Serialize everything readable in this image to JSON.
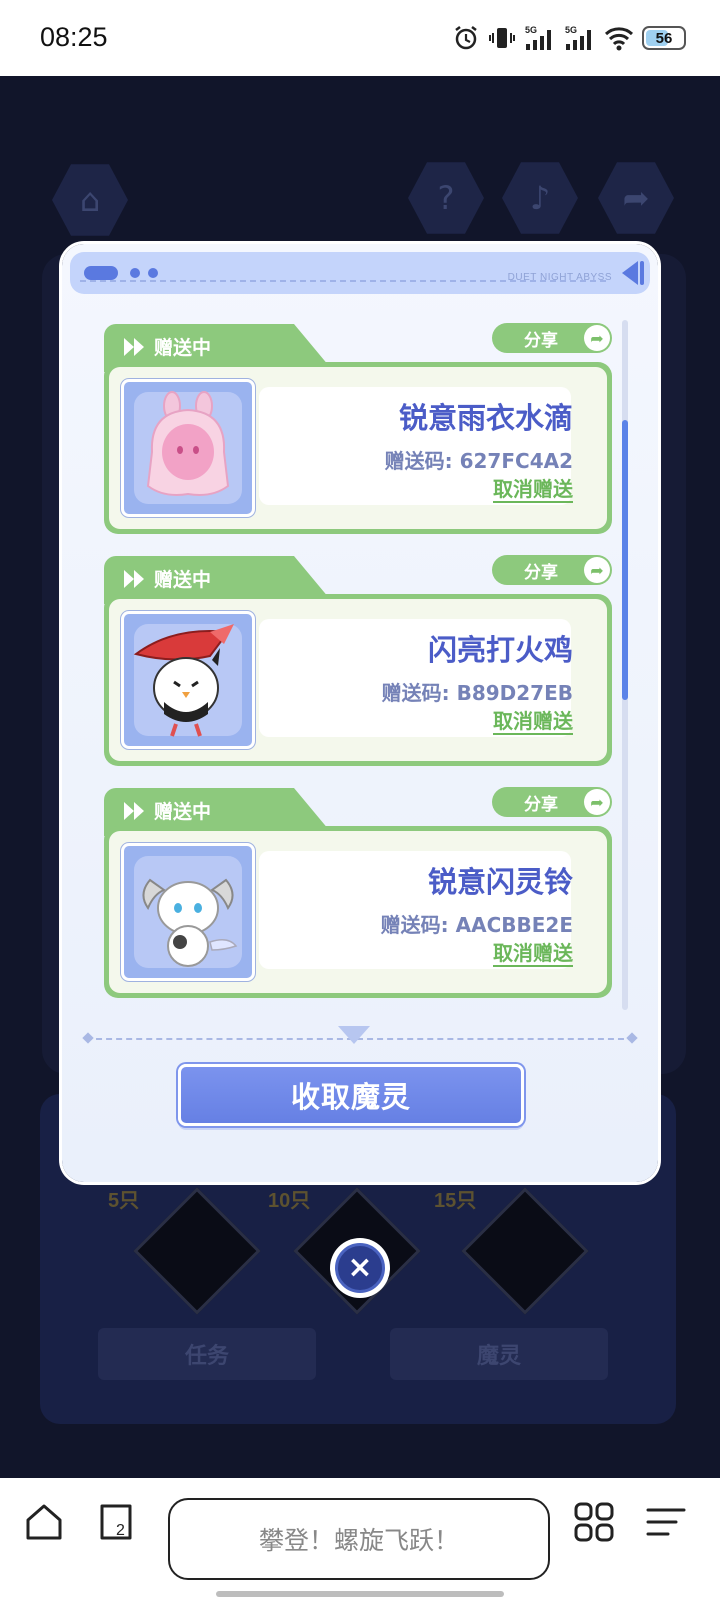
{
  "status_bar": {
    "time": "08:25",
    "signal_label_1": "5G",
    "signal_label_2": "5G",
    "battery": "56"
  },
  "background_game": {
    "counts": [
      "5只",
      "10只",
      "15只"
    ],
    "tab_task": "任务",
    "tab_spirit": "魔灵"
  },
  "dialog": {
    "header_tag": "DUET NIGHT ABYSS",
    "cards": [
      {
        "status": "赠送中",
        "share": "分享",
        "name": "锐意雨衣水滴",
        "code": "赠送码: 627FC4A2",
        "cancel": "取消赠送"
      },
      {
        "status": "赠送中",
        "share": "分享",
        "name": "闪亮打火鸡",
        "code": "赠送码: B89D27EB",
        "cancel": "取消赠送"
      },
      {
        "status": "赠送中",
        "share": "分享",
        "name": "锐意闪灵铃",
        "code": "赠送码: AACBBE2E",
        "cancel": "取消赠送"
      }
    ],
    "collect_button": "收取魔灵",
    "close_icon": "×"
  },
  "browser_bar": {
    "address_text": "攀登！螺旋飞跃！",
    "tab_count": "2"
  },
  "colors": {
    "card_green": "#8dc97d",
    "accent_blue": "#6680e4",
    "name_blue": "#4b5cc7"
  }
}
